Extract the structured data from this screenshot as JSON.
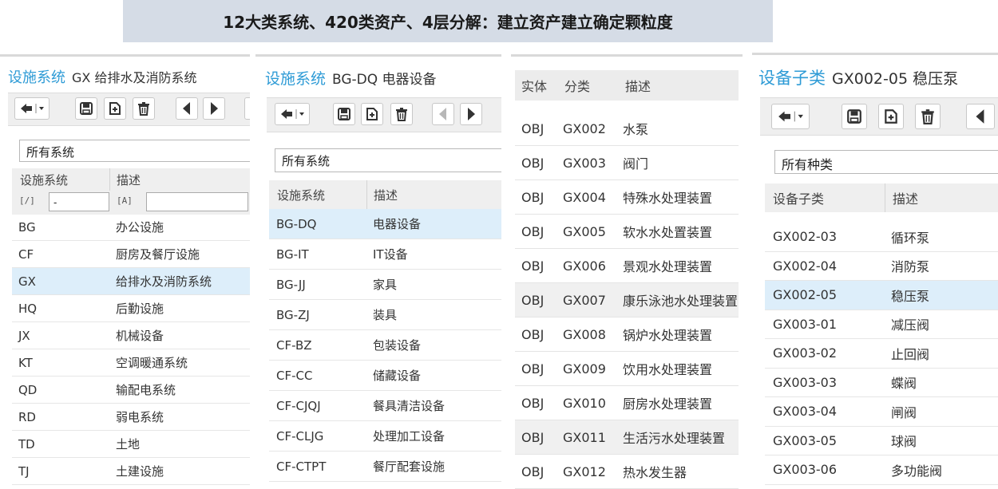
{
  "banner": "12大类系统、420类资产、4层分解：建立资产建立确定颗粒度",
  "panel1": {
    "title_key": "设施系统",
    "title_value": "GX 给排水及消防系统",
    "filter_value": "所有系统",
    "columns": [
      "设施系统",
      "描述"
    ],
    "filter_code_value": "-",
    "filter_code_icon": "[/]",
    "filter_desc_icon": "[A]",
    "rows": [
      {
        "code": "BG",
        "desc": "办公设施"
      },
      {
        "code": "CF",
        "desc": "厨房及餐厅设施"
      },
      {
        "code": "GX",
        "desc": "给排水及消防系统"
      },
      {
        "code": "HQ",
        "desc": "后勤设施"
      },
      {
        "code": "JX",
        "desc": "机械设备"
      },
      {
        "code": "KT",
        "desc": "空调暖通系统"
      },
      {
        "code": "QD",
        "desc": "输配电系统"
      },
      {
        "code": "RD",
        "desc": "弱电系统"
      },
      {
        "code": "TD",
        "desc": "土地"
      },
      {
        "code": "TJ",
        "desc": "土建设施"
      }
    ]
  },
  "panel2": {
    "title_key": "设施系统",
    "title_value": "BG-DQ 电器设备",
    "filter_value": "所有系统",
    "columns": [
      "设施系统",
      "描述"
    ],
    "rows": [
      {
        "code": "BG-DQ",
        "desc": "电器设备"
      },
      {
        "code": "BG-IT",
        "desc": "IT设备"
      },
      {
        "code": "BG-JJ",
        "desc": "家具"
      },
      {
        "code": "BG-ZJ",
        "desc": "装具"
      },
      {
        "code": "CF-BZ",
        "desc": "包装设备"
      },
      {
        "code": "CF-CC",
        "desc": "储藏设备"
      },
      {
        "code": "CF-CJQJ",
        "desc": "餐具清洁设备"
      },
      {
        "code": "CF-CLJG",
        "desc": "处理加工设备"
      },
      {
        "code": "CF-CTPT",
        "desc": "餐厅配套设施"
      }
    ]
  },
  "panel3": {
    "columns": [
      "实体",
      "分类",
      "描述"
    ],
    "rows": [
      {
        "entity": "OBJ",
        "class": "GX002",
        "desc": "水泵"
      },
      {
        "entity": "OBJ",
        "class": "GX003",
        "desc": "阀门"
      },
      {
        "entity": "OBJ",
        "class": "GX004",
        "desc": "特殊水处理装置"
      },
      {
        "entity": "OBJ",
        "class": "GX005",
        "desc": "软水水处置装置"
      },
      {
        "entity": "OBJ",
        "class": "GX006",
        "desc": "景观水处理装置"
      },
      {
        "entity": "OBJ",
        "class": "GX007",
        "desc": "康乐泳池水处理装置"
      },
      {
        "entity": "OBJ",
        "class": "GX008",
        "desc": "锅炉水处理装置"
      },
      {
        "entity": "OBJ",
        "class": "GX009",
        "desc": "饮用水处理装置"
      },
      {
        "entity": "OBJ",
        "class": "GX010",
        "desc": "厨房水处理装置"
      },
      {
        "entity": "OBJ",
        "class": "GX011",
        "desc": "生活污水处理装置"
      },
      {
        "entity": "OBJ",
        "class": "GX012",
        "desc": "热水发生器"
      }
    ]
  },
  "panel4": {
    "title_key": "设备子类",
    "title_value": "GX002-05 稳压泵",
    "filter_value": "所有种类",
    "columns": [
      "设备子类",
      "描述"
    ],
    "rows": [
      {
        "code": "GX002-03",
        "desc": "循环泵"
      },
      {
        "code": "GX002-04",
        "desc": "消防泵"
      },
      {
        "code": "GX002-05",
        "desc": "稳压泵"
      },
      {
        "code": "GX003-01",
        "desc": "减压阀"
      },
      {
        "code": "GX003-02",
        "desc": "止回阀"
      },
      {
        "code": "GX003-03",
        "desc": "蝶阀"
      },
      {
        "code": "GX003-04",
        "desc": "闸阀"
      },
      {
        "code": "GX003-05",
        "desc": "球阀"
      },
      {
        "code": "GX003-06",
        "desc": "多功能阀"
      }
    ]
  },
  "icons": [
    "back-icon",
    "save-icon",
    "new-record-icon",
    "delete-icon",
    "previous-icon",
    "next-icon"
  ]
}
